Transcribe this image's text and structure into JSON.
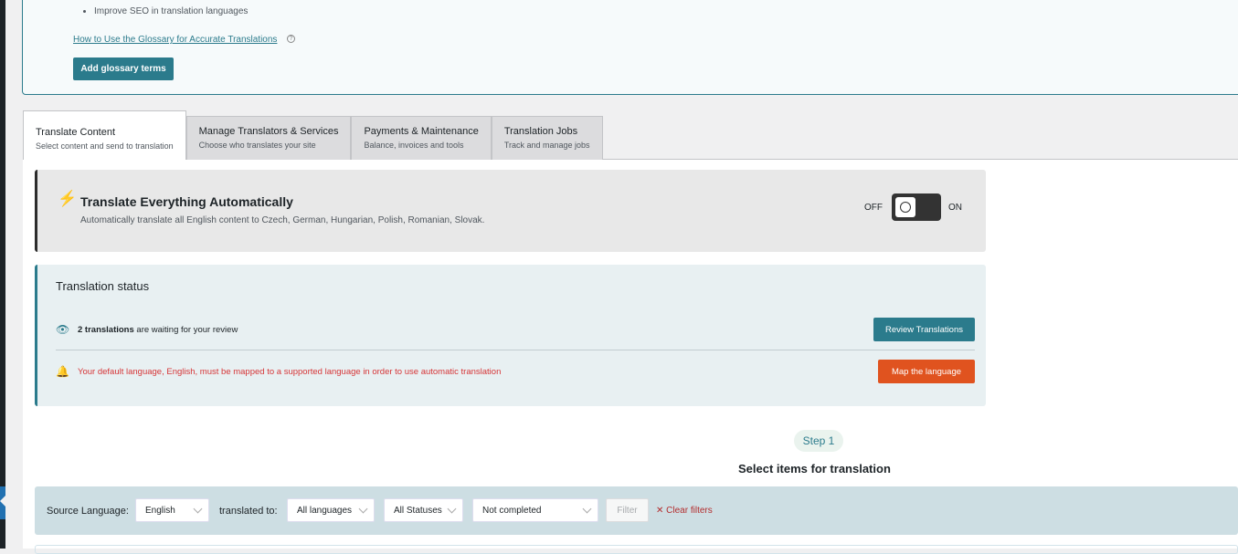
{
  "glossary": {
    "bullet": "Improve SEO in translation languages",
    "link": "How to Use the Glossary for Accurate Translations",
    "button": "Add glossary terms"
  },
  "tabs": [
    {
      "title": "Translate Content",
      "subtitle": "Select content and send to translation"
    },
    {
      "title": "Manage Translators & Services",
      "subtitle": "Choose who translates your site"
    },
    {
      "title": "Payments & Maintenance",
      "subtitle": "Balance, invoices and tools"
    },
    {
      "title": "Translation Jobs",
      "subtitle": "Track and manage jobs"
    }
  ],
  "auto": {
    "title": "Translate Everything Automatically",
    "description": "Automatically translate all English content to Czech, German, Hungarian, Polish, Romanian, Slovak.",
    "off": "OFF",
    "on": "ON",
    "enabled": false
  },
  "status": {
    "title": "Translation status",
    "review_count": "2 translations",
    "review_text": " are waiting for your review",
    "review_button": "Review Translations",
    "warning": "Your default language, English, must be mapped to a supported language in order to use automatic translation",
    "map_button": "Map the language"
  },
  "step": {
    "label": "Step 1",
    "title": "Select items for translation"
  },
  "filters": {
    "source_label": "Source Language:",
    "source": "English",
    "to_label": "translated to:",
    "to": "All languages",
    "statuses": "All Statuses",
    "completion": "Not completed",
    "filter_button": "Filter",
    "clear": "Clear filters"
  }
}
